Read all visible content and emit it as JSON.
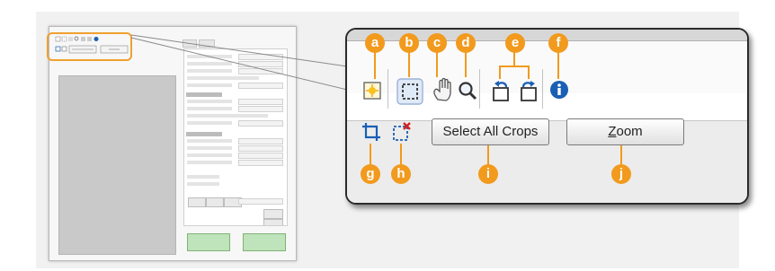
{
  "colors": {
    "callout": "#f29a1d",
    "highlight": "#f0a030",
    "panel_bg": "#f1f1f1",
    "info_blue": "#1a5fb4"
  },
  "toolbar_row1": {
    "auto_crop_icon": "auto-crop-icon",
    "crop_select_icon": "dotted-rectangle-icon",
    "pan_icon": "hand-icon",
    "zoom_icon": "magnifier-icon",
    "rotate_left_icon": "rotate-left-icon",
    "rotate_right_icon": "rotate-right-icon",
    "info_icon": "info-icon"
  },
  "toolbar_row2": {
    "crop_frame_icon": "crop-frame-icon",
    "delete_crop_icon": "delete-crop-icon",
    "select_all_label": "Select All Crops",
    "zoom_label_pre": "",
    "zoom_label_mnemonic": "Z",
    "zoom_label_post": "oom"
  },
  "callouts": {
    "a": "a",
    "b": "b",
    "c": "c",
    "d": "d",
    "e": "e",
    "f": "f",
    "g": "g",
    "h": "h",
    "i": "i",
    "j": "j"
  }
}
